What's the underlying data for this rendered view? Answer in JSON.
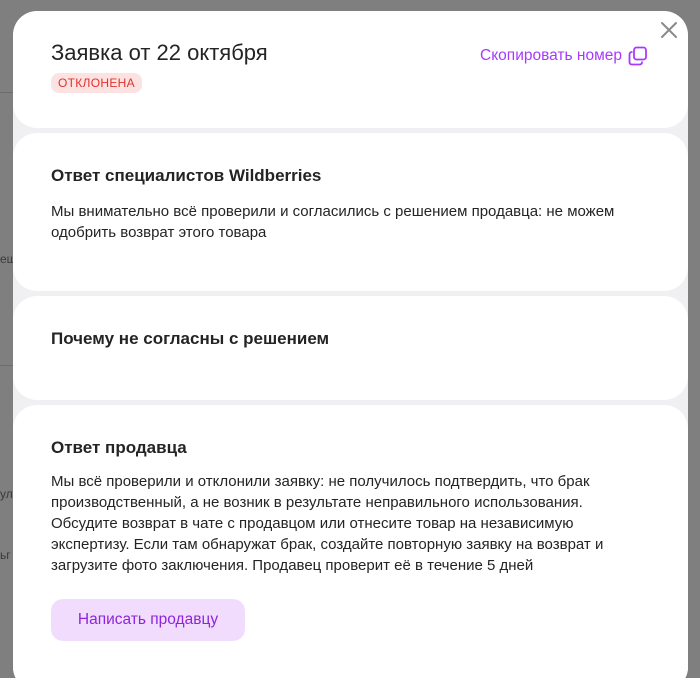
{
  "background": {
    "peeks": [
      "еш",
      "ул",
      "ьг"
    ]
  },
  "header": {
    "title": "Заявка от 22 октября",
    "status_badge": "ОТКЛОНЕНА",
    "copy_label": "Скопировать номер",
    "copy_icon": "copy-icon",
    "close_icon": "close-icon"
  },
  "specialists": {
    "heading": "Ответ специалистов Wildberries",
    "text": "Мы внимательно всё проверили и согласились с решением продавца: не можем одобрить возврат этого товара"
  },
  "disagree": {
    "heading": "Почему не согласны с решением"
  },
  "seller": {
    "heading": "Ответ продавца",
    "text": "Мы всё проверили и отклонили заявку: не получилось подтвердить, что брак производственный, а не возник в результате неправильного использования. Обсудите возврат в чате с продавцом или отнесите товар на независимую экспертизу. Если там обнаружат брак, создайте повторную заявку на возврат и загрузите фото заключения. Продавец проверит её в течение 5 дней",
    "button_label": "Написать продавцу"
  },
  "colors": {
    "accent": "#a73afd",
    "badge_bg": "#fde2e2",
    "badge_text": "#e0322e",
    "button_bg": "#f2dcfe"
  }
}
